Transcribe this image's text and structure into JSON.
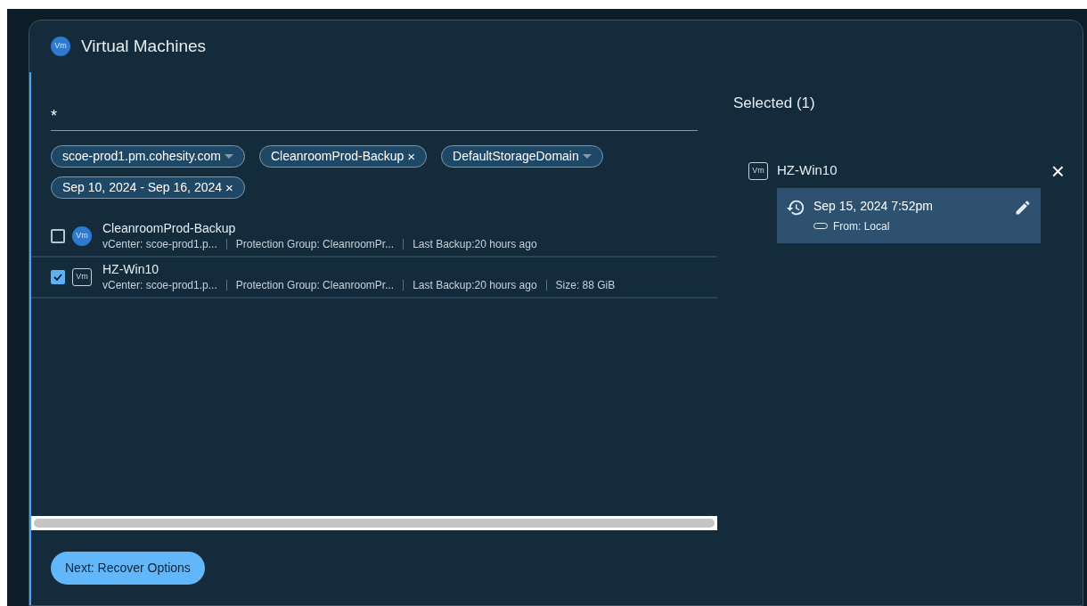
{
  "dialog": {
    "icon": "Vm",
    "title": "Virtual Machines"
  },
  "search": {
    "value": "*"
  },
  "filters": [
    {
      "label": "scoe-prod1.pm.cohesity.com",
      "kind": "dropdown"
    },
    {
      "label": "CleanroomProd-Backup",
      "kind": "removable",
      "remove": "×"
    },
    {
      "label": "DefaultStorageDomain",
      "kind": "dropdown"
    },
    {
      "label": "Sep 10, 2024 - Sep 16, 2024",
      "kind": "removable",
      "remove": "×"
    }
  ],
  "rows": [
    {
      "checked": false,
      "kind": "filled",
      "icon": "Vm",
      "name": "CleanroomProd-Backup",
      "meta": [
        "vCenter:  scoe-prod1.p...",
        "Protection Group:  CleanroomPr...",
        "Last Backup:20 hours ago"
      ]
    },
    {
      "checked": true,
      "kind": "outline",
      "icon": "Vm",
      "name": "HZ-Win10",
      "meta": [
        "vCenter:  scoe-prod1.p...",
        "Protection Group:  CleanroomPr...",
        "Last Backup:20 hours ago",
        "Size:  88 GiB"
      ]
    }
  ],
  "next_button": "Next: Recover Options",
  "selected_panel": {
    "title": "Selected (1)",
    "items": [
      {
        "icon": "Vm",
        "name": "HZ-Win10",
        "close": "×",
        "snapshot": {
          "time": "Sep 15, 2024 7:52pm",
          "source": "From: Local"
        }
      }
    ]
  }
}
